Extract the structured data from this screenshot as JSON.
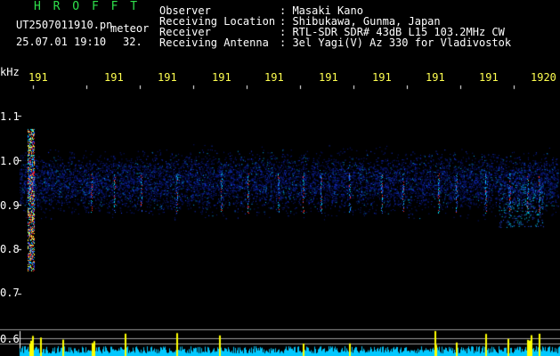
{
  "header": {
    "program": "H R O F F T",
    "filename": "UT2507011910.pn",
    "type": "meteor",
    "datetime": "25.07.01 19:10",
    "count": "32.",
    "fields": [
      {
        "label": "Observer",
        "value": ": Masaki Kano"
      },
      {
        "label": "Receiving Location",
        "value": ": Shibukawa, Gunma, Japan"
      },
      {
        "label": "Receiver",
        "value": ": RTL-SDR SDR# 43dB L15 103.2MHz CW"
      },
      {
        "label": "Receiving Antenna",
        "value": ": 3el Yagi(V) Az 330 for Vladivostok"
      }
    ]
  },
  "axis": {
    "unit": "kHz",
    "y_ticks": [
      "1.1",
      "1.0",
      "0.9",
      "0.8",
      "0.7",
      "0.6"
    ],
    "x_ticks": [
      "191",
      "191",
      "191",
      "191",
      "191",
      "191",
      "191",
      "191",
      "191",
      "1920"
    ]
  },
  "colors": {
    "background": "#000000",
    "label_green": "#2fe04b",
    "tick_yellow": "#ffff50",
    "bottom_band": "#ffff00",
    "spectrum_cyan": "#00d0ff"
  }
}
